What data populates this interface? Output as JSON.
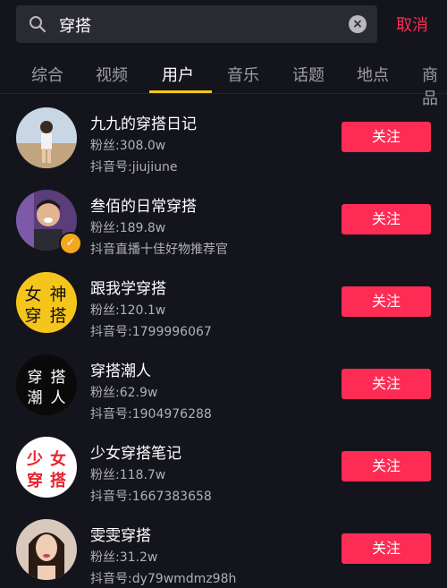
{
  "search": {
    "query": "穿搭",
    "cancel_label": "取消"
  },
  "tabs": [
    {
      "label": "综合"
    },
    {
      "label": "视频"
    },
    {
      "label": "用户"
    },
    {
      "label": "音乐"
    },
    {
      "label": "话题"
    },
    {
      "label": "地点"
    },
    {
      "label": "商品"
    }
  ],
  "active_tab_color": "#f7c71b",
  "accent_color": "#fe2c55",
  "users": [
    {
      "name": "九九的穿搭日记",
      "fans": "粉丝:308.0w",
      "id_line": "抖音号:jiujiune",
      "follow_label": "关注",
      "verified": false
    },
    {
      "name": "叁佰的日常穿搭",
      "fans": "粉丝:189.8w",
      "id_line": "抖音直播十佳好物推荐官",
      "follow_label": "关注",
      "verified": true
    },
    {
      "name": "跟我学穿搭",
      "fans": "粉丝:120.1w",
      "id_line": "抖音号:1799996067",
      "follow_label": "关注",
      "verified": false,
      "avatar_text": [
        "女",
        "神",
        "穿",
        "搭"
      ]
    },
    {
      "name": "穿搭潮人",
      "fans": "粉丝:62.9w",
      "id_line": "抖音号:1904976288",
      "follow_label": "关注",
      "verified": false,
      "avatar_text": [
        "穿",
        "搭",
        "潮",
        "人"
      ]
    },
    {
      "name": "少女穿搭笔记",
      "fans": "粉丝:118.7w",
      "id_line": "抖音号:1667383658",
      "follow_label": "关注",
      "verified": false,
      "avatar_text": [
        "少",
        "女",
        "穿",
        "搭"
      ]
    },
    {
      "name": "雯雯穿搭",
      "fans": "粉丝:31.2w",
      "id_line": "抖音号:dy79wmdmz98h",
      "follow_label": "关注",
      "verified": false
    }
  ]
}
